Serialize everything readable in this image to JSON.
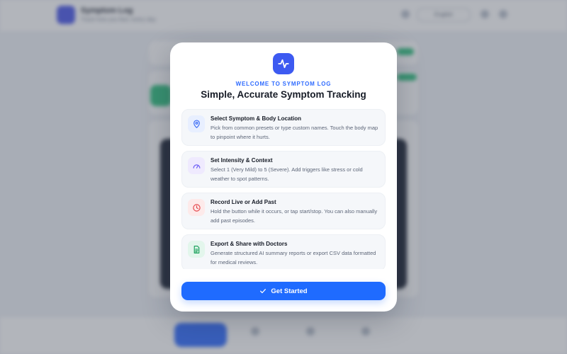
{
  "background": {
    "app_title": "Symptom Log",
    "app_subtitle": "Track how you feel, every day",
    "language": "English"
  },
  "modal": {
    "eyebrow": "WELCOME TO SYMPTOM LOG",
    "headline": "Simple, Accurate Symptom Tracking",
    "app_icon": "activity-pulse-icon",
    "features": [
      {
        "icon": "map-pin-icon",
        "title": "Select Symptom & Body Location",
        "description": "Pick from common presets or type custom names. Touch the body map to pinpoint where it hurts."
      },
      {
        "icon": "gauge-icon",
        "title": "Set Intensity & Context",
        "description": "Select 1 (Very Mild) to 5 (Severe). Add triggers like stress or cold weather to spot patterns."
      },
      {
        "icon": "clock-icon",
        "title": "Record Live or Add Past",
        "description": "Hold the button while it occurs, or tap start/stop. You can also manually add past episodes."
      },
      {
        "icon": "document-icon",
        "title": "Export & Share with Doctors",
        "description": "Generate structured AI summary reports or export CSV data formatted for medical reviews."
      }
    ],
    "cta_label": "Get Started",
    "cta_icon": "check-icon"
  },
  "colors": {
    "accent": "#1f6bff",
    "app_icon_bg": "#3d5af1",
    "pin": "#3b6cf6",
    "gauge": "#6b5cf6",
    "clock": "#e5484d",
    "document": "#1fa35f"
  }
}
